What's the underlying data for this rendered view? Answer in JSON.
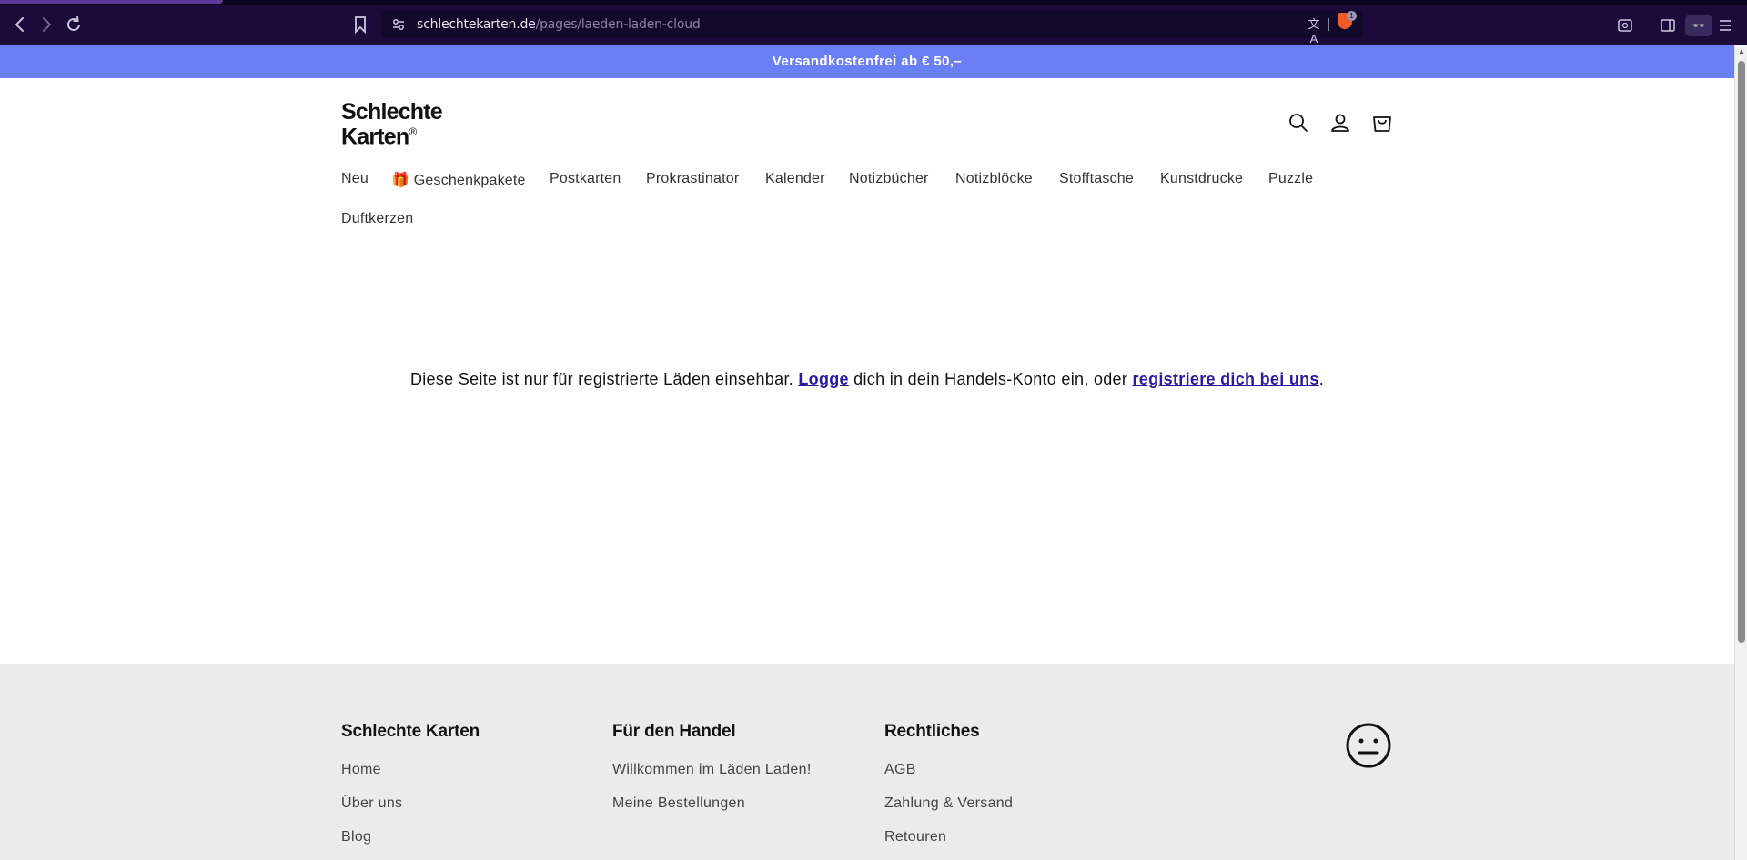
{
  "browser": {
    "url_domain": "schlechtekarten.de",
    "url_path": "/pages/laeden-laden-cloud",
    "back_icon": "chevron-left-icon",
    "forward_icon": "chevron-right-icon",
    "reload_icon": "reload-icon",
    "brave_badge": "1"
  },
  "announcement": {
    "text": "Versandkostenfrei ab € 50,–"
  },
  "header": {
    "logo_line1": "Schlechte",
    "logo_line2": "Karten",
    "logo_mark": "®"
  },
  "nav": {
    "items": [
      {
        "label": "Neu"
      },
      {
        "label": "🎁 Geschenkpakete"
      },
      {
        "label": "Postkarten"
      },
      {
        "label": "Prokrastinator"
      },
      {
        "label": "Kalender"
      },
      {
        "label": "Notizbücher"
      },
      {
        "label": "Notizblöcke"
      },
      {
        "label": "Stofftasche"
      },
      {
        "label": "Kunstdrucke"
      },
      {
        "label": "Puzzle"
      },
      {
        "label": "Duftkerzen"
      }
    ]
  },
  "main": {
    "notice_part1": "Diese Seite ist nur für registrierte Läden einsehbar. ",
    "login_link": "Logge",
    "notice_part2": " dich in dein Handels-Konto ein, oder ",
    "register_link": "registriere dich bei uns",
    "notice_part3": "."
  },
  "footer": {
    "col1": {
      "heading": "Schlechte Karten",
      "links": [
        "Home",
        "Über uns",
        "Blog"
      ]
    },
    "col2": {
      "heading": "Für den Handel",
      "links": [
        "Willkommen im Läden Laden!",
        "Meine Bestellungen"
      ]
    },
    "col3": {
      "heading": "Rechtliches",
      "links": [
        "AGB",
        "Zahlung & Versand",
        "Retouren"
      ]
    }
  },
  "colors": {
    "browser_bg": "#1c0b3a",
    "announcement_bg": "#6b7ff5",
    "link_color": "#2c1a9e",
    "footer_bg": "#ebebeb"
  }
}
